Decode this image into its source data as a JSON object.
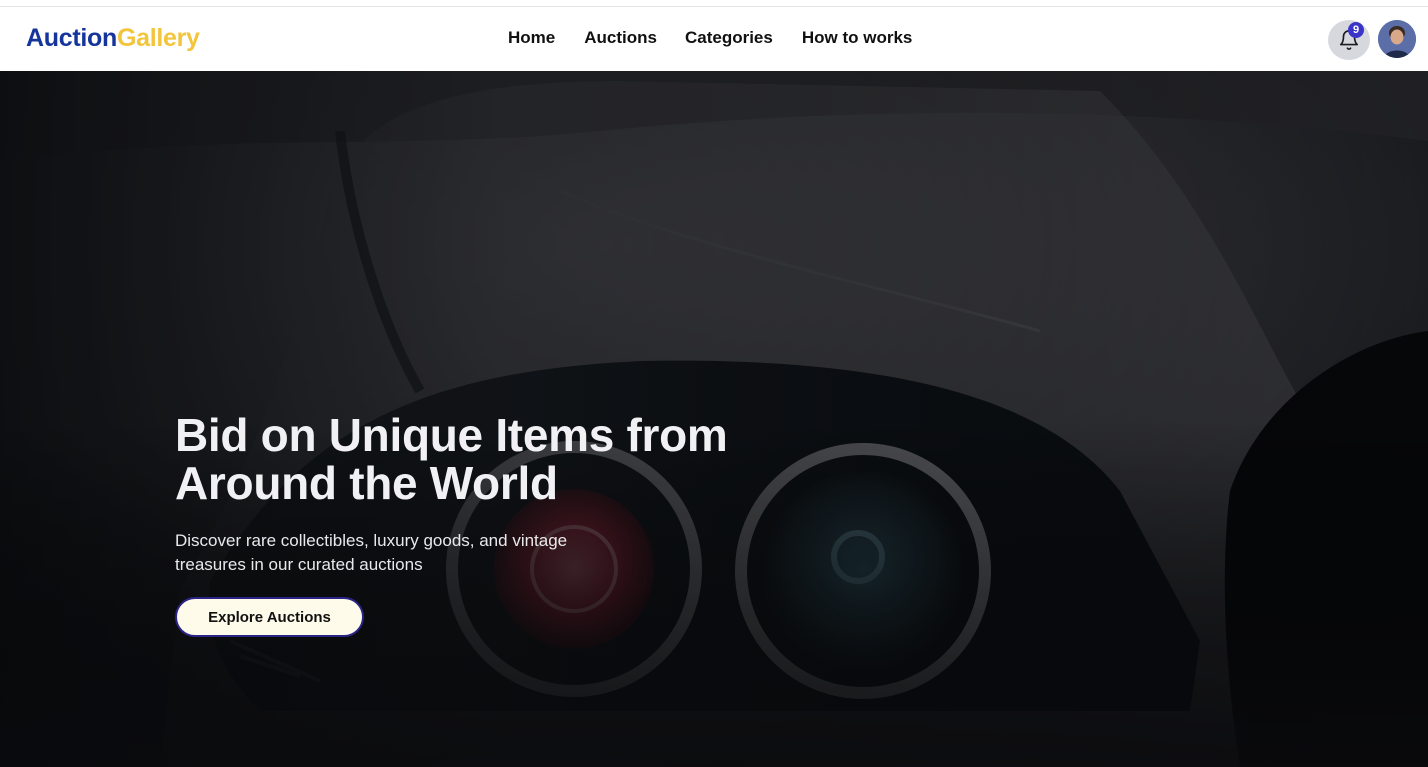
{
  "brand": {
    "part1": "Auction",
    "part2": "Gallery",
    "color1": "#16359b",
    "color2": "#f2c53d"
  },
  "nav": {
    "home": "Home",
    "auctions": "Auctions",
    "categories": "Categories",
    "how": "How to works"
  },
  "notifications": {
    "icon": "bell-icon",
    "count": "9",
    "badge_color": "#3b34c9"
  },
  "user": {
    "icon": "avatar"
  },
  "hero": {
    "title_line1": "Bid on Unique Items from",
    "title_line2": "Around the World",
    "subtitle_line1": "Discover rare collectibles, luxury goods, and vintage",
    "subtitle_line2": "treasures in our curated auctions",
    "cta": "Explore Auctions",
    "background": "car-headlights-photo"
  }
}
